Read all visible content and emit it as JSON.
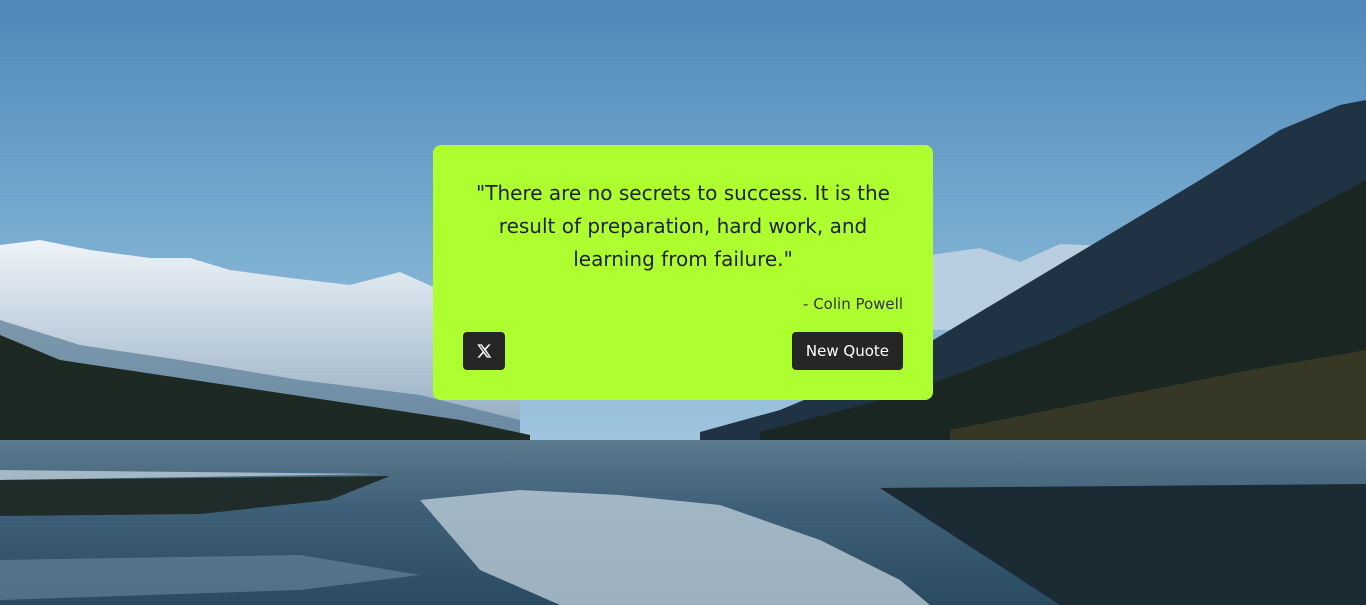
{
  "quote": {
    "text": "\"There are no secrets to success. It is the result of preparation, hard work, and learning from failure.\"",
    "author": "- Colin Powell"
  },
  "actions": {
    "new_quote_label": "New Quote",
    "tweet_icon": "x-logo-icon"
  },
  "colors": {
    "card_background": "#adff2f",
    "button_background": "#262626",
    "button_text": "#ffffff",
    "quote_text": "#222222"
  }
}
